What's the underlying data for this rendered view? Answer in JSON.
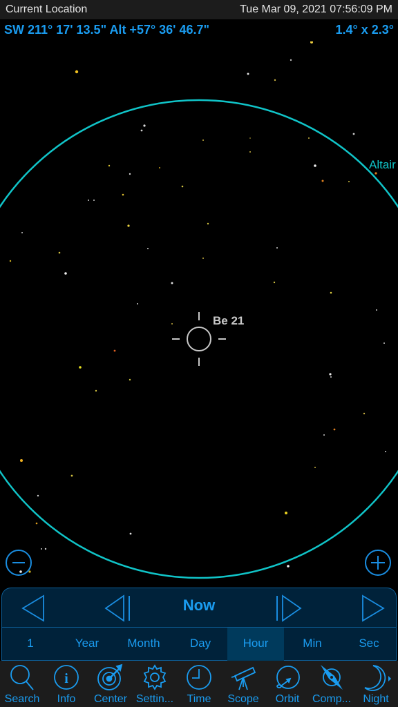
{
  "header": {
    "location": "Current Location",
    "datetime": "Tue Mar 09, 2021  07:56:09 PM"
  },
  "coordinates": {
    "position": "SW 211° 17' 13.5\" Alt +57° 36' 46.7\"",
    "field_of_view": "1.4° x  2.3°"
  },
  "sky": {
    "target_label": "Be 21",
    "circle_label": "Altair",
    "colors": {
      "circle": "#10c4c8",
      "target": "#c8c8c8",
      "accent": "#1a9cf0"
    }
  },
  "zoom_controls": {
    "zoom_out": "zoom-out",
    "zoom_in": "zoom-in"
  },
  "time_panel": {
    "now_label": "Now",
    "units": [
      "1",
      "Year",
      "Month",
      "Day",
      "Hour",
      "Min",
      "Sec"
    ],
    "active_unit": "Hour"
  },
  "toolbar": {
    "items": [
      {
        "label": "Search",
        "icon": "search-icon"
      },
      {
        "label": "Info",
        "icon": "info-icon"
      },
      {
        "label": "Center",
        "icon": "target-icon"
      },
      {
        "label": "Settin...",
        "icon": "gear-icon"
      },
      {
        "label": "Time",
        "icon": "clock-icon"
      },
      {
        "label": "Scope",
        "icon": "telescope-icon"
      },
      {
        "label": "Orbit",
        "icon": "orbit-icon"
      },
      {
        "label": "Comp...",
        "icon": "compass-icon"
      },
      {
        "label": "Night",
        "icon": "moon-icon"
      }
    ]
  }
}
